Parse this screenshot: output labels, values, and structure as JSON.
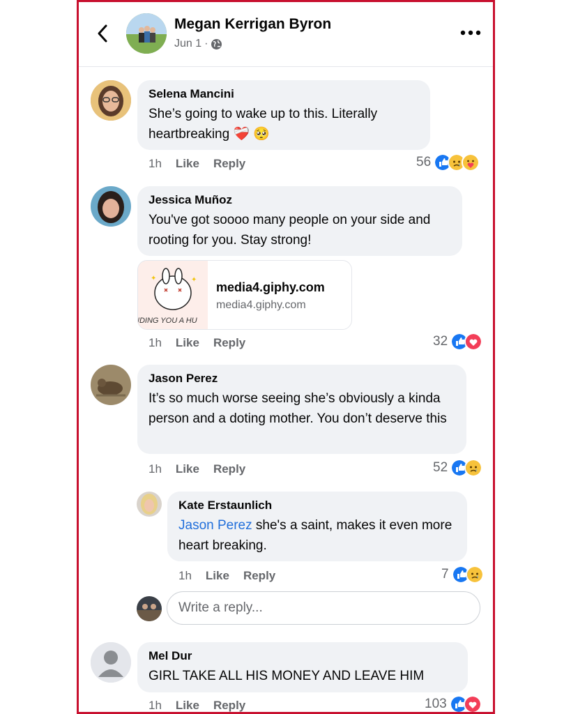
{
  "header": {
    "name": "Megan Kerrigan Byron",
    "date": "Jun 1",
    "dot": "·"
  },
  "comments": [
    {
      "author": "Selena Mancini",
      "text": "She’s going to wake up to this. Literally heartbreaking ❤️‍🩹 🥺",
      "time": "1h",
      "like": "Like",
      "reply": "Reply",
      "count": "56",
      "reactions": [
        "like-icon",
        "sad-icon",
        "care-icon"
      ]
    },
    {
      "author": "Jessica Muñoz",
      "text": "You've got soooo many people on your side and rooting for you. Stay strong!",
      "link": {
        "title": "media4.giphy.com",
        "subtitle": "media4.giphy.com",
        "thumb_text": "NDING YOU A HU"
      },
      "time": "1h",
      "like": "Like",
      "reply": "Reply",
      "count": "32",
      "reactions": [
        "like-icon",
        "love-icon"
      ]
    },
    {
      "author": "Jason Perez",
      "text": "It’s so much worse seeing she’s obviously a kinda person and a doting mother. You don’t deserve this",
      "time": "1h",
      "like": "Like",
      "reply": "Reply",
      "count": "52",
      "reactions": [
        "like-icon",
        "sad-icon"
      ]
    },
    {
      "author": "Kate Erstaunlich",
      "mention": "Jason Perez",
      "text": " she's a saint, makes it even more heart breaking.",
      "time": "1h",
      "like": "Like",
      "reply": "Reply",
      "count": "7",
      "reactions": [
        "like-icon",
        "sad-icon"
      ]
    },
    {
      "author": "Mel Dur",
      "text": "GIRL TAKE ALL HIS MONEY AND LEAVE HIM",
      "time": "1h",
      "like": "Like",
      "reply": "Reply",
      "count": "103",
      "reactions": [
        "like-icon",
        "love-icon"
      ]
    }
  ],
  "reply_box": {
    "placeholder": "Write a reply..."
  },
  "colors": {
    "frame": "#c8102e",
    "like": "#1877f2",
    "love": "#f33e58",
    "mention": "#216fdb"
  }
}
